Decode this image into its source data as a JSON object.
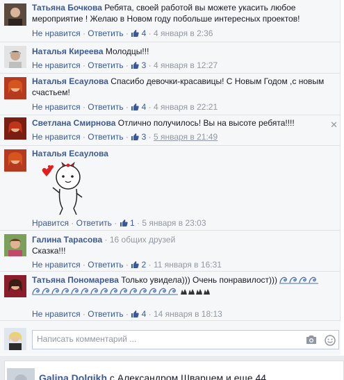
{
  "comments": [
    {
      "author": "Татьяна Бочкова",
      "text": "Ребята, своей работой вы можете укасить любое мероприятие ! Желаю в Новом году побольше интересных проектов!",
      "like_action": "Не нравится",
      "reply_action": "Ответить",
      "likes": "4",
      "time": "4 января в 2:36"
    },
    {
      "author": "Наталья Киреева",
      "text": "Молодцы!!!",
      "like_action": "Не нравится",
      "reply_action": "Ответить",
      "likes": "3",
      "time": "4 января в 12:27"
    },
    {
      "author": "Наталья Есаулова",
      "text": "Спасибо девочки-красавицы! С Новым Годом ,с новым счастьем!",
      "like_action": "Не нравится",
      "reply_action": "Ответить",
      "likes": "4",
      "time": "4 января в 22:21"
    },
    {
      "author": "Светлана Смирнова",
      "text": "Отлично получилось! Вы на высоте ребята!!!!",
      "like_action": "Не нравится",
      "reply_action": "Ответить",
      "likes": "3",
      "time": "5 января в 21:49"
    },
    {
      "author": "Наталья Есаулова",
      "text": "",
      "like_action": "Нравится",
      "reply_action": "Ответить",
      "likes": "1",
      "time": "5 января в 23:03"
    },
    {
      "author": "Галина Тарасова",
      "friends": "16 общих друзей",
      "text": "Сказка!!!",
      "like_action": "Не нравится",
      "reply_action": "Ответить",
      "likes": "2",
      "time": "11 января в 16:31"
    },
    {
      "author": "Татьяна Пономарева",
      "text": "Только увидела))) Очень понравилост)))",
      "like_action": "Не нравится",
      "reply_action": "Ответить",
      "likes": "4",
      "time": "14 января в 18:13"
    }
  ],
  "separator": "·",
  "close_glyph": "✕",
  "reply": {
    "placeholder": "Написать комментарий ..."
  },
  "next_post": {
    "author": "Galina Dolgikh",
    "text": "с Александром Шварцем и еще 44"
  },
  "colors": {
    "link": "#3b5998",
    "muted": "#9197a3",
    "panel": "#f6f7f8"
  },
  "icons": [
    "thumbs-up-icon",
    "close-icon",
    "camera-icon",
    "smile-icon",
    "wave-emoji-icon",
    "sticker-icon"
  ]
}
